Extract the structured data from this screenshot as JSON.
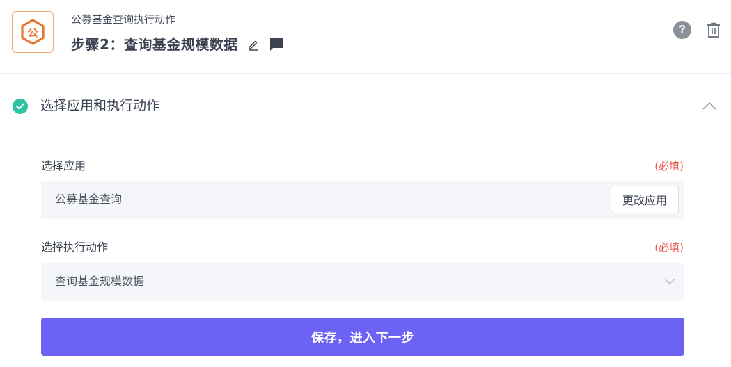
{
  "header": {
    "app_logo_icon": "gong-fund-logo",
    "app_logo_text": "公",
    "app_name": "公募基金查询执行动作",
    "step_title": "步骤2：查询基金规模数据",
    "edit_icon": "pencil-icon",
    "comment_icon": "comment-icon",
    "help_label": "?",
    "delete_icon": "trash-icon"
  },
  "section": {
    "title": "选择应用和执行动作",
    "status_icon": "check-circle-icon",
    "toggle_icon": "chevron-up-icon"
  },
  "app_field": {
    "label": "选择应用",
    "required": "(必填)",
    "value": "公募基金查询",
    "change_button": "更改应用"
  },
  "action_field": {
    "label": "选择执行动作",
    "required": "(必填)",
    "value": "查询基金规模数据",
    "dropdown_icon": "chevron-down-icon"
  },
  "submit_button": "保存，进入下一步",
  "colors": {
    "accent": "#6c63f5",
    "success": "#2ec4a1",
    "required": "#e8584f",
    "logo": "#e8742a"
  }
}
